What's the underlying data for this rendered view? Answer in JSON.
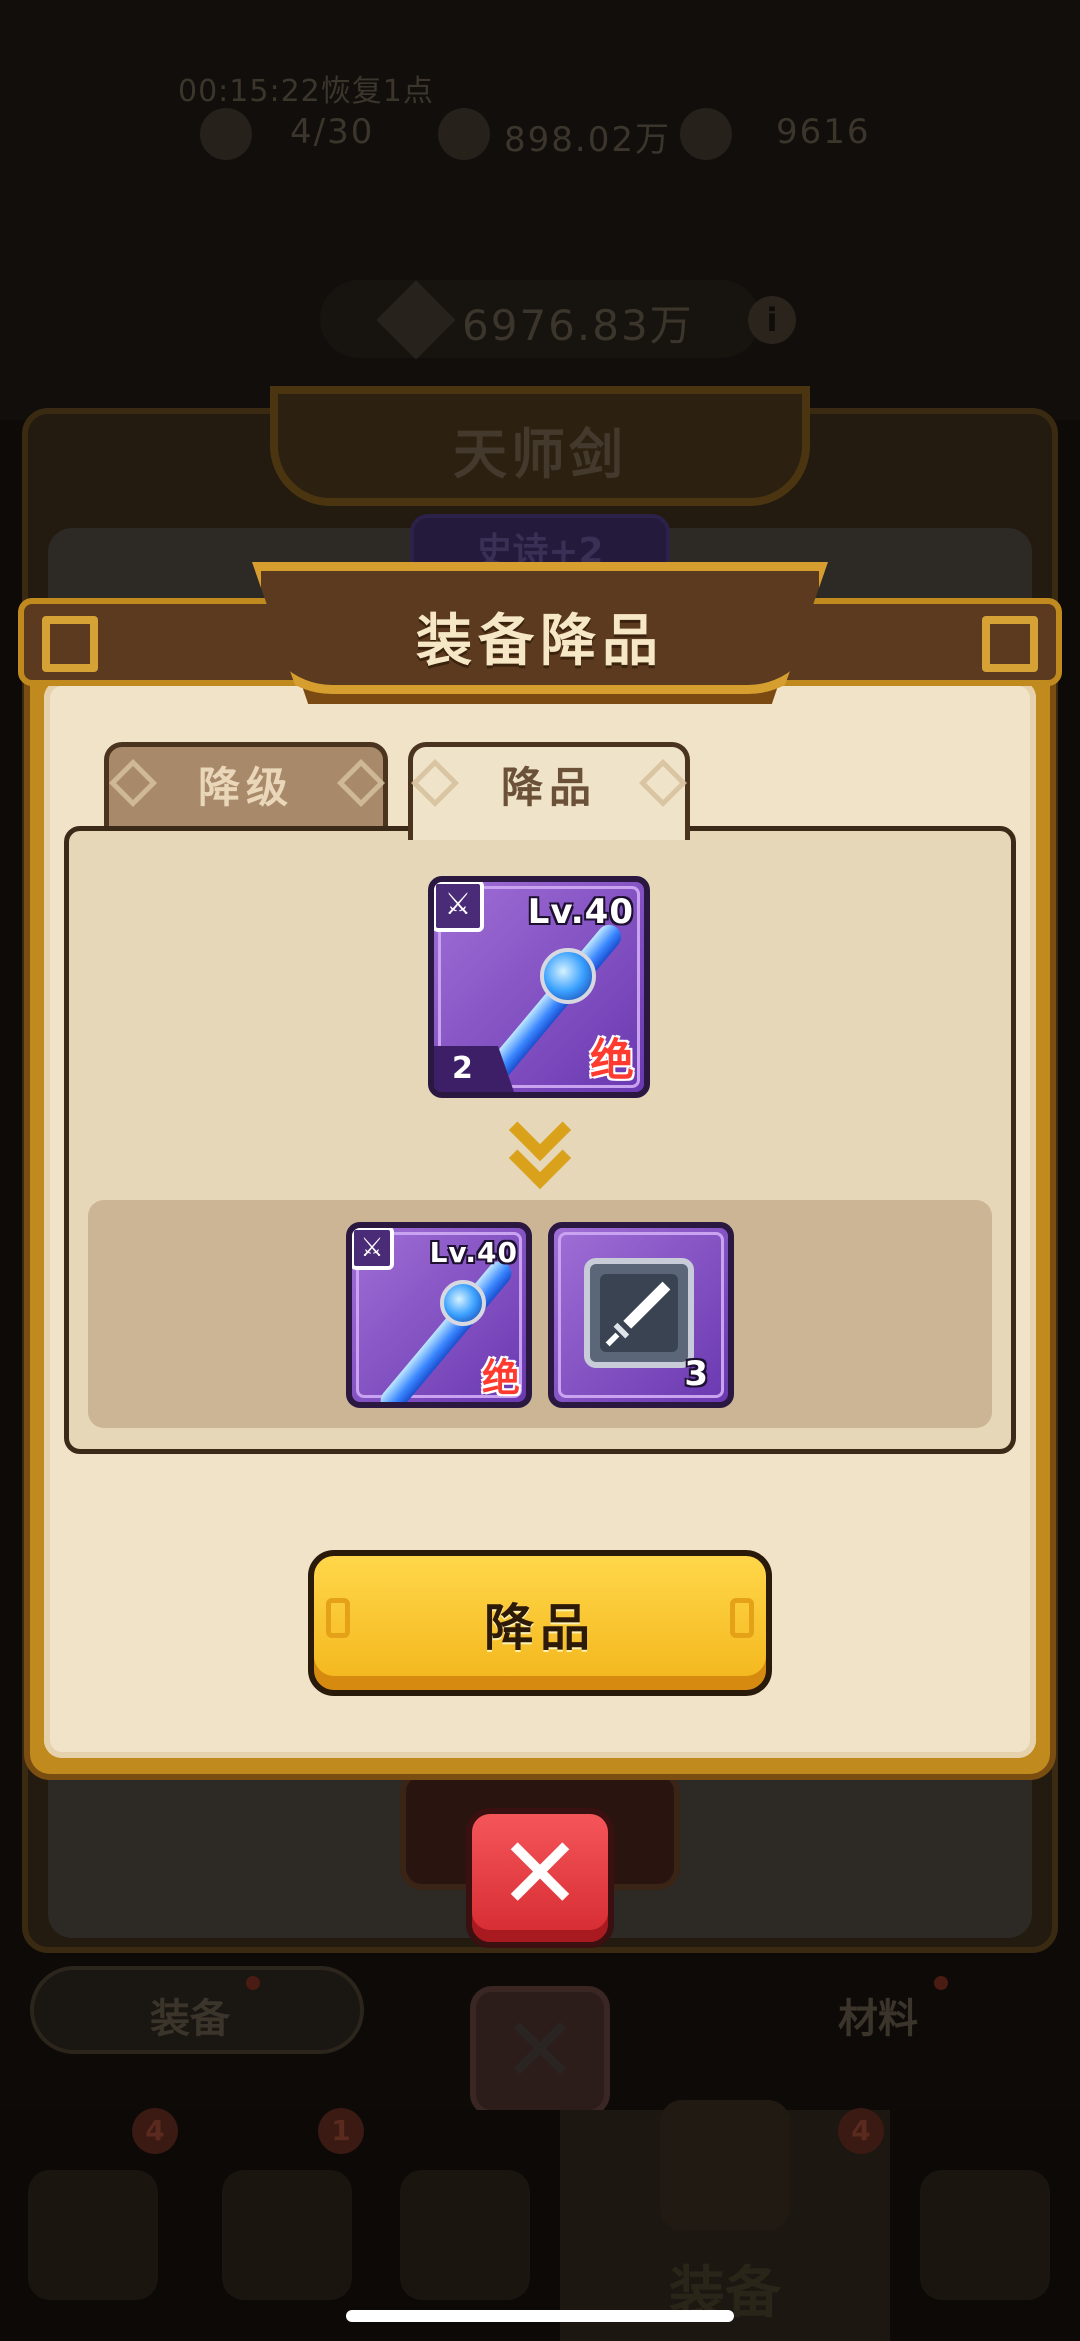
{
  "background": {
    "timer": "00:15:22恢复1点",
    "resources": [
      {
        "name": "energy",
        "icon": "energy-icon",
        "value": "4/30"
      },
      {
        "name": "gold",
        "icon": "gold-coin-icon",
        "value": "898.02万"
      },
      {
        "name": "gems",
        "icon": "gem-icon",
        "value": "9616"
      }
    ],
    "combat_power": "6976.83万",
    "item_title": "天师剑",
    "item_quality": "史诗+2",
    "bottom_tabs": [
      "装备",
      "材料"
    ],
    "nav_badges": [
      "4",
      "1",
      "4"
    ],
    "nav_selected": "装备"
  },
  "dialog": {
    "title": "装备降品",
    "tabs": [
      {
        "label": "降级",
        "active": false
      },
      {
        "label": "降品",
        "active": true
      }
    ],
    "source_item": {
      "level": "Lv.40",
      "rank": "绝",
      "stars": "2",
      "type_icon": "sword-icon"
    },
    "result_items": [
      {
        "kind": "equipment",
        "level": "Lv.40",
        "rank": "绝",
        "type_icon": "sword-icon"
      },
      {
        "kind": "material",
        "icon": "sword-material-icon",
        "count": "3"
      }
    ],
    "action_label": "降品",
    "close_icon": "close-icon"
  },
  "colors": {
    "frame_gold": "#c08a1f",
    "panel_brown": "#5b3a20",
    "body_cream": "#f0e3c8",
    "epic_purple": "#8a55c8",
    "button_yellow": "#f7c52e",
    "close_red": "#e0383e",
    "rank_red": "#ff3b2f"
  }
}
